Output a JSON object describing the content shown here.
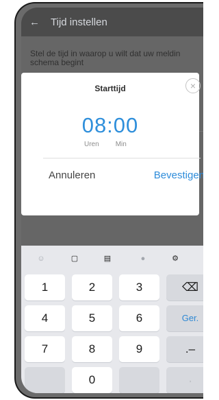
{
  "appbar": {
    "title": "Tijd instellen"
  },
  "content": {
    "description_line1": "Stel de tijd in waarop u wilt dat uw meldin",
    "description_line2": "schema begint"
  },
  "dialog": {
    "title": "Starttijd",
    "time_value": "08:00",
    "label_hours": "Uren",
    "label_minutes": "Min",
    "cancel_label": "Annuleren",
    "confirm_label": "Bevestigen"
  },
  "keyboard": {
    "toolbar_icons": [
      "emoji-icon",
      "clipboard-icon",
      "text-edit-icon",
      "microphone-icon",
      "settings-icon"
    ],
    "rows": [
      [
        "1",
        "2",
        "3",
        "⌫"
      ],
      [
        "4",
        "5",
        "6",
        "Ger."
      ],
      [
        "7",
        "8",
        "9",
        ".–"
      ],
      [
        "",
        "0",
        "",
        ","
      ]
    ]
  },
  "colors": {
    "accent": "#2f8fdb",
    "overlay": "#666666"
  }
}
